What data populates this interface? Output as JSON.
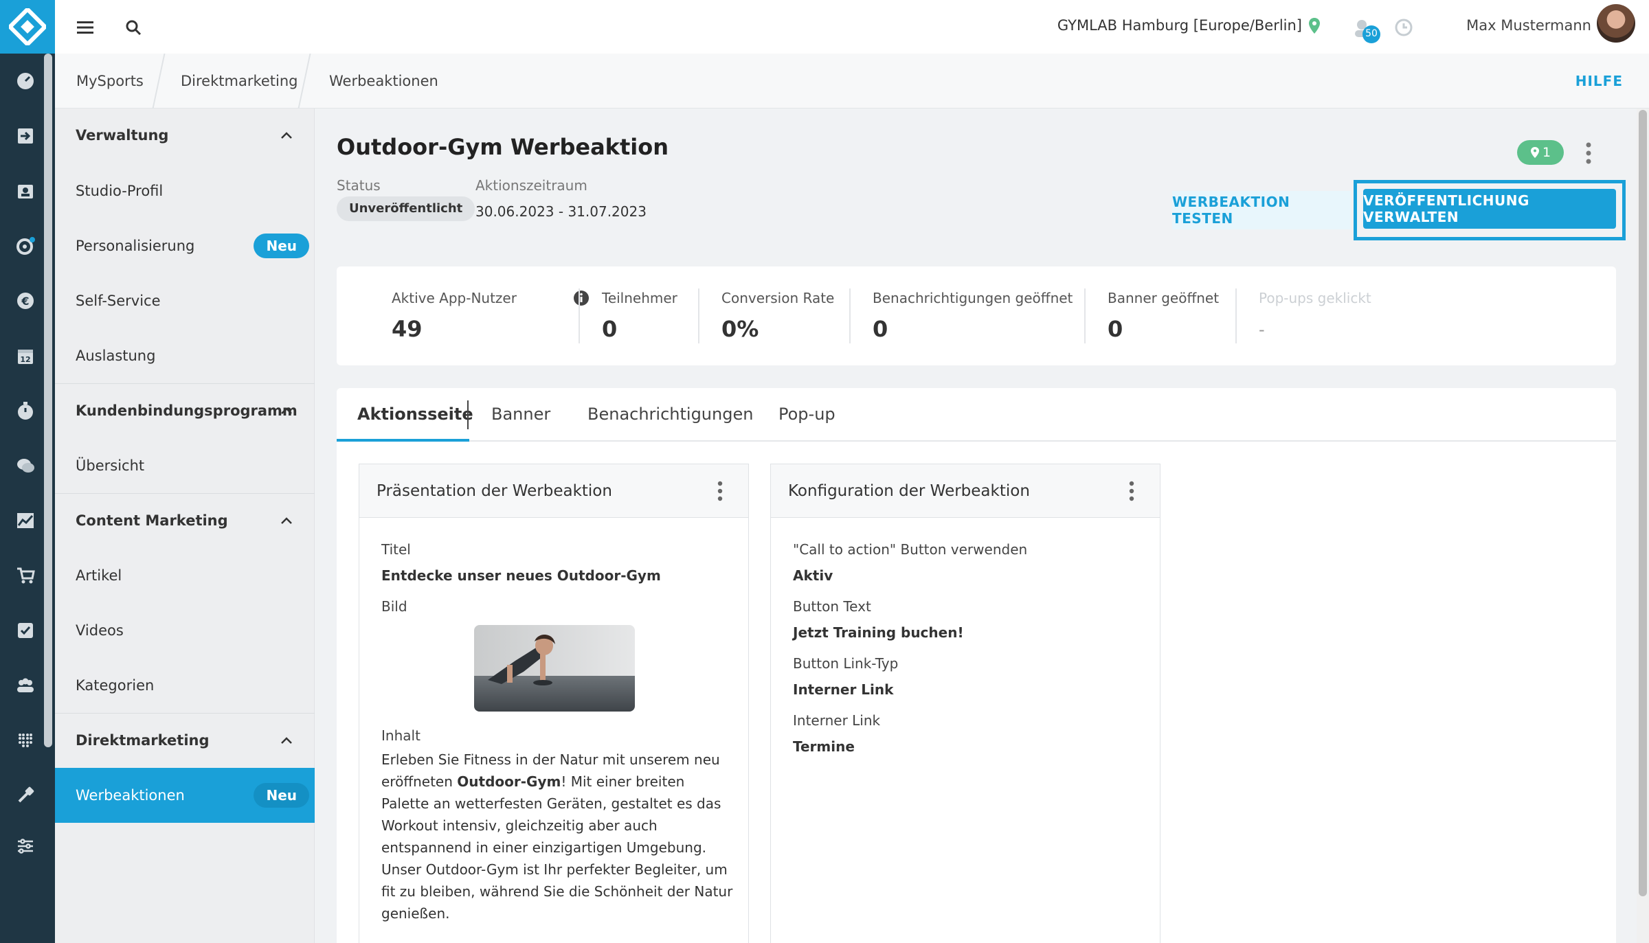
{
  "topbar": {
    "location": "GYMLAB Hamburg [Europe/Berlin]",
    "notification_count": "50",
    "user_name": "Max Mustermann"
  },
  "breadcrumb": {
    "items": [
      "MySports",
      "Direktmarketing",
      "Werbeaktionen"
    ],
    "help": "HILFE"
  },
  "sidebar": {
    "sections": [
      {
        "title": "Verwaltung",
        "items": [
          "Studio-Profil",
          "Personalisierung",
          "Self-Service",
          "Auslastung"
        ]
      },
      {
        "title": "Kundenbindungsprogramm",
        "items": [
          "Übersicht"
        ]
      },
      {
        "title": "Content Marketing",
        "items": [
          "Artikel",
          "Videos",
          "Kategorien"
        ]
      },
      {
        "title": "Direktmarketing",
        "items": [
          "Werbeaktionen"
        ]
      }
    ],
    "badge_new": "Neu"
  },
  "header": {
    "title": "Outdoor-Gym Werbeaktion",
    "status_label": "Status",
    "status_value": "Unveröffentlicht",
    "period_label": "Aktionszeitraum",
    "period_value": "30.06.2023 - 31.07.2023",
    "location_count": "1",
    "test_button": "WERBEAKTION TESTEN",
    "publish_button": "VERÖFFENTLICHUNG VERWALTEN"
  },
  "stats": [
    {
      "label": "Aktive App-Nutzer",
      "value": "49"
    },
    {
      "label": "Teilnehmer",
      "value": "0"
    },
    {
      "label": "Conversion Rate",
      "value": "0%"
    },
    {
      "label": "Benachrichtigungen geöffnet",
      "value": "0"
    },
    {
      "label": "Banner geöffnet",
      "value": "0"
    },
    {
      "label": "Pop-ups geklickt",
      "value": "-"
    }
  ],
  "tabs": [
    "Aktionsseite",
    "Banner",
    "Benachrichtigungen",
    "Pop-up"
  ],
  "presentation": {
    "title": "Präsentation der Werbeaktion",
    "title_label": "Titel",
    "title_value": "Entdecke unser neues Outdoor-Gym",
    "image_label": "Bild",
    "content_label": "Inhalt",
    "content_before": "Erleben Sie Fitness in der Natur mit unserem neu eröffneten ",
    "content_bold": "Outdoor-Gym",
    "content_after": "! Mit einer breiten Palette an wetterfesten Geräten, gestaltet es das Workout intensiv, gleichzeitig aber auch entspannend in einer einzigartigen Umgebung. Unser Outdoor-Gym ist Ihr perfekter Begleiter, um fit zu bleiben, während Sie die Schönheit der Natur genießen."
  },
  "configuration": {
    "title": "Konfiguration der Werbeaktion",
    "fields": [
      {
        "label": "\"Call to action\" Button verwenden",
        "value": "Aktiv"
      },
      {
        "label": "Button Text",
        "value": "Jetzt Training buchen!"
      },
      {
        "label": "Button Link-Typ",
        "value": "Interner Link"
      },
      {
        "label": "Interner Link",
        "value": "Termine"
      }
    ]
  },
  "colors": {
    "accent": "#1aa0d8",
    "rail": "#1f3644",
    "success": "#5cc08a"
  }
}
